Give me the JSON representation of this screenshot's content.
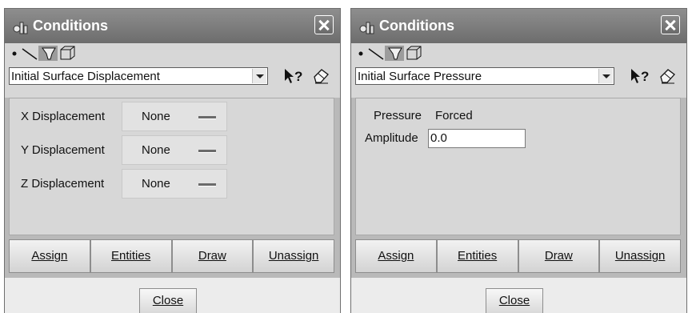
{
  "colors": {
    "titlebar": "#6d6d6d",
    "panel": "#d7d7d7",
    "frame": "#b9b9b9"
  },
  "dialogs": [
    {
      "title": "Conditions",
      "condition_type": "Initial Surface Displacement",
      "geometry_icons": [
        "point-icon",
        "line-icon",
        "surface-icon",
        "volume-icon"
      ],
      "fields": [
        {
          "label": "X Displacement",
          "value": "None"
        },
        {
          "label": "Y Displacement",
          "value": "None"
        },
        {
          "label": "Z Displacement",
          "value": "None"
        }
      ],
      "actions": [
        "Assign",
        "Entities",
        "Draw",
        "Unassign"
      ],
      "close_label": "Close"
    },
    {
      "title": "Conditions",
      "condition_type": "Initial Surface Pressure",
      "geometry_icons": [
        "point-icon",
        "line-icon",
        "surface-icon",
        "volume-icon"
      ],
      "pressure_label": "Pressure",
      "pressure_value": "Forced",
      "amplitude_label": "Amplitude",
      "amplitude_value": "0.0",
      "actions": [
        "Assign",
        "Entities",
        "Draw",
        "Unassign"
      ],
      "close_label": "Close"
    }
  ]
}
